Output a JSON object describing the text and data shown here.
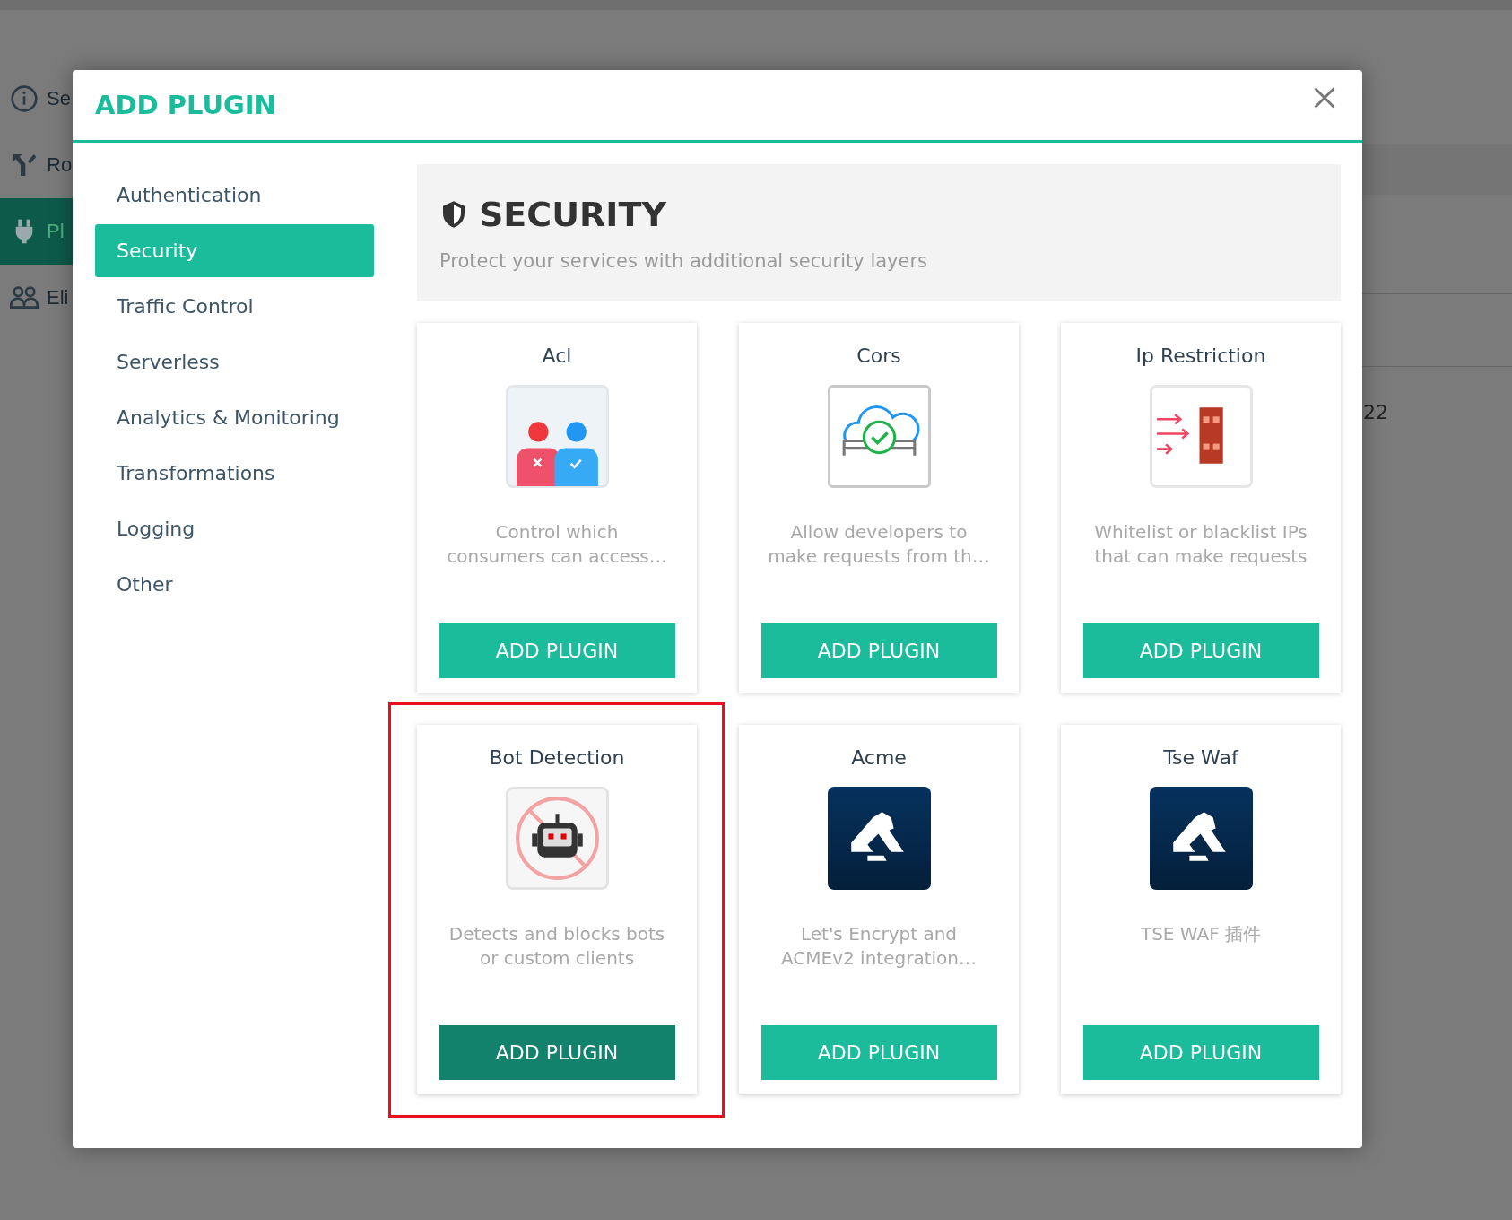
{
  "background": {
    "nav_items": [
      {
        "label": "Se",
        "selected": false
      },
      {
        "label": "Ro",
        "selected": false
      },
      {
        "label": "Pl",
        "selected": true
      },
      {
        "label": "Eli",
        "selected": false
      }
    ],
    "cell_text": "22"
  },
  "dialog": {
    "title": "ADD PLUGIN",
    "categories": [
      {
        "label": "Authentication",
        "selected": false
      },
      {
        "label": "Security",
        "selected": true
      },
      {
        "label": "Traffic Control",
        "selected": false
      },
      {
        "label": "Serverless",
        "selected": false
      },
      {
        "label": "Analytics & Monitoring",
        "selected": false
      },
      {
        "label": "Transformations",
        "selected": false
      },
      {
        "label": "Logging",
        "selected": false
      },
      {
        "label": "Other",
        "selected": false
      }
    ],
    "section": {
      "title": "SECURITY",
      "subtitle": "Protect your services with additional security layers"
    },
    "plugins": [
      {
        "name": "Acl",
        "description": "Control which consumers can access…",
        "button": "ADD PLUGIN",
        "highlighted": false,
        "hovered": false
      },
      {
        "name": "Cors",
        "description": "Allow developers to make requests from th…",
        "button": "ADD PLUGIN",
        "highlighted": false,
        "hovered": false
      },
      {
        "name": "Ip Restriction",
        "description": "Whitelist or blacklist IPs that can make requests",
        "button": "ADD PLUGIN",
        "highlighted": false,
        "hovered": false
      },
      {
        "name": "Bot Detection",
        "description": "Detects and blocks bots or custom clients",
        "button": "ADD PLUGIN",
        "highlighted": true,
        "hovered": true
      },
      {
        "name": "Acme",
        "description": "Let's Encrypt and ACMEv2 integration…",
        "button": "ADD PLUGIN",
        "highlighted": false,
        "hovered": false
      },
      {
        "name": "Tse Waf",
        "description": "TSE WAF 插件",
        "button": "ADD PLUGIN",
        "highlighted": false,
        "hovered": false
      }
    ]
  }
}
